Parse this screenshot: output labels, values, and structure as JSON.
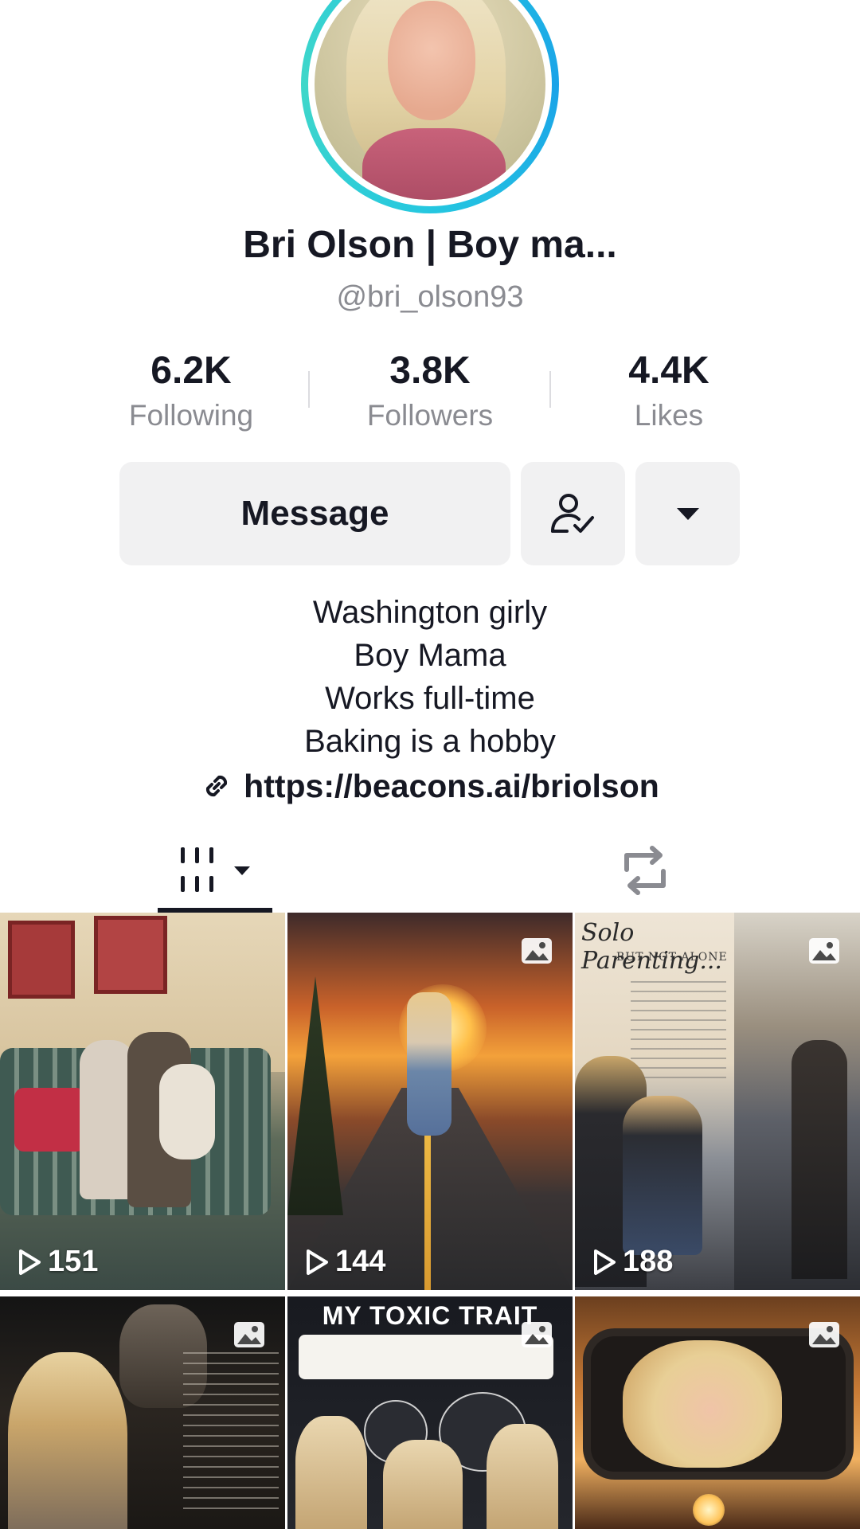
{
  "profile": {
    "display_name": "Bri Olson | Boy ma...",
    "username": "@bri_olson93"
  },
  "stats": {
    "following": {
      "value": "6.2K",
      "label": "Following"
    },
    "followers": {
      "value": "3.8K",
      "label": "Followers"
    },
    "likes": {
      "value": "4.4K",
      "label": "Likes"
    }
  },
  "actions": {
    "message_label": "Message",
    "friend_icon": "person-check-icon",
    "more_icon": "caret-down-icon"
  },
  "bio": {
    "lines": [
      "Washington girly",
      "Boy Mama",
      "Works full-time",
      "Baking is a hobby"
    ],
    "link": "https://beacons.ai/briolson",
    "link_icon": "link-icon"
  },
  "tabs": {
    "videos_icon": "video-grid-icon",
    "reposts_icon": "repost-icon"
  },
  "grid": {
    "items": [
      {
        "type": "video",
        "views": "151"
      },
      {
        "type": "video",
        "views": "144",
        "badge": "photo-icon"
      },
      {
        "type": "video",
        "views": "188",
        "badge": "photo-icon",
        "title": "Solo Parenting...",
        "subtitle": "BUT NOT ALONE"
      },
      {
        "type": "photo",
        "badge": "photo-icon"
      },
      {
        "type": "photo",
        "badge": "photo-icon",
        "title": "MY TOXIC TRAIT"
      },
      {
        "type": "photo",
        "badge": "photo-icon"
      }
    ]
  },
  "colors": {
    "text_primary": "#161823",
    "text_secondary": "#8a8b91",
    "button_bg": "#f1f1f2",
    "avatar_ring": "#25c7e0"
  }
}
